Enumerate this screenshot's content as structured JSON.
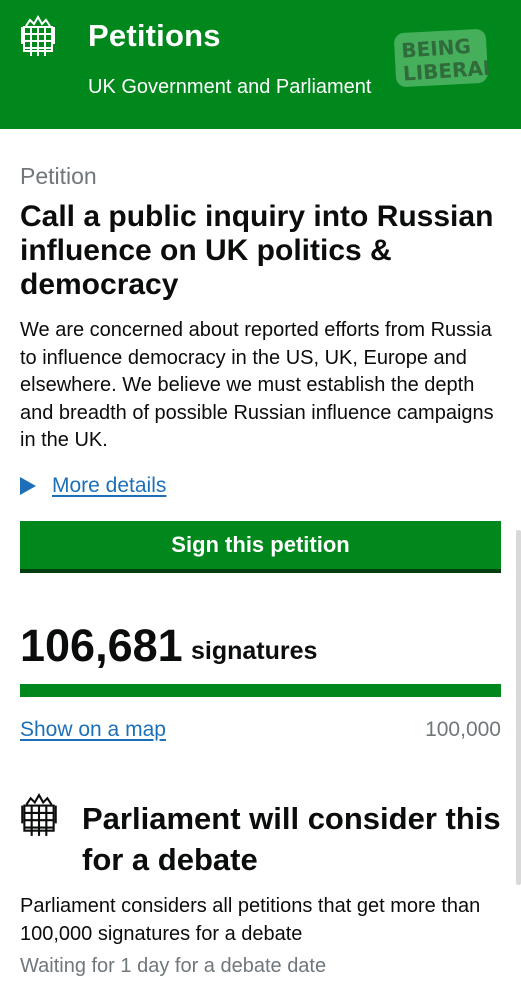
{
  "header": {
    "title": "Petitions",
    "subtitle": "UK Government and Parliament",
    "logo_icon": "portcullis-icon",
    "watermark": "BEING LIBERAL",
    "color": "#00881c"
  },
  "petition": {
    "kicker": "Petition",
    "title": "Call a public inquiry into Russian influence on UK politics & democracy",
    "summary": "We are concerned about reported efforts from Russia to influence democracy in the US, UK, Europe and elsewhere. We believe we must establish the depth and breadth of possible Russian influence campaigns in the UK.",
    "more_details": "More details",
    "sign_button": "Sign this petition"
  },
  "signatures": {
    "count": "106,681",
    "label": "signatures",
    "progress_fraction": 1.0,
    "map_link": "Show on a map",
    "threshold": "100,000"
  },
  "debate": {
    "icon": "portcullis-icon",
    "title": "Parliament will consider this for a debate",
    "description": "Parliament considers all petitions that get more than 100,000 signatures for a debate",
    "status": "Waiting for 1 day for a debate date"
  },
  "colors": {
    "brand_green": "#00881c",
    "link_blue": "#1d70b8",
    "secondary_text": "#6f777b"
  }
}
